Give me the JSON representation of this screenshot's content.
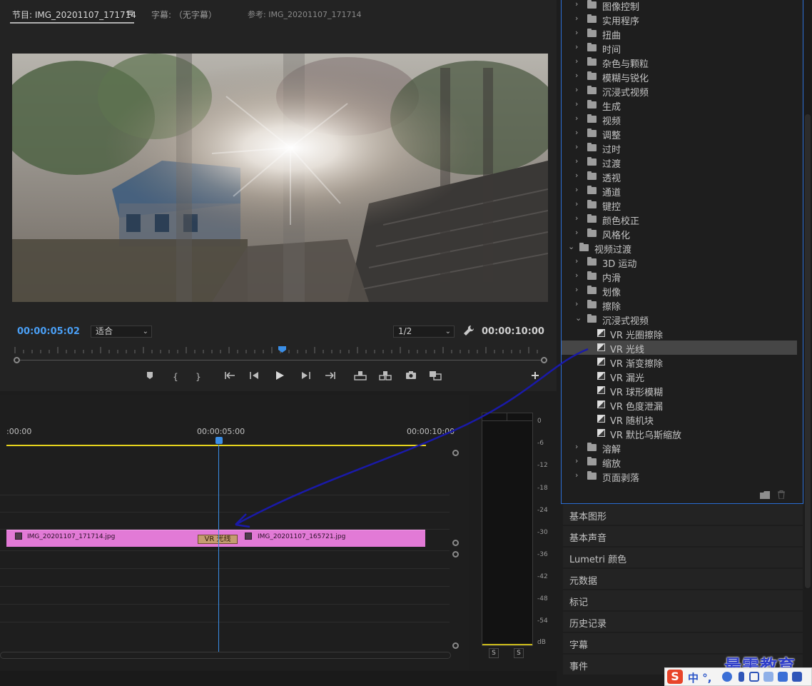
{
  "program_monitor": {
    "tab_program": "节目: IMG_20201107_171714",
    "tab_menu_icon": "hamburger-icon",
    "tab_captions": "字幕: （无字幕）",
    "tab_reference": "参考: IMG_20201107_171714",
    "current_timecode": "00:00:05:02",
    "total_timecode": "00:00:10:00",
    "fit_value": "适合",
    "resolution_value": "1/2",
    "transport_icons": [
      "marker-icon",
      "mark-in-icon",
      "mark-out-icon",
      "go-to-in-icon",
      "step-back-icon",
      "play-icon",
      "step-forward-icon",
      "go-to-out-icon",
      "lift-icon",
      "extract-icon",
      "camera-icon",
      "compare-icon",
      "add-button-icon"
    ]
  },
  "timeline": {
    "ruler_labels": [
      ":00:00",
      "00:00:05:00",
      "00:00:10:00"
    ],
    "clip_a": "IMG_20201107_171714.jpg",
    "clip_b": "IMG_20201107_165721.jpg",
    "transition": "VR 光线",
    "clip_color": "#e27ad6",
    "transition_color": "#c49c6f",
    "playhead_color": "#3a8ee6"
  },
  "audio_meter": {
    "db_labels": [
      "0",
      "-6",
      "-12",
      "-18",
      "-24",
      "-30",
      "-36",
      "-42",
      "-48",
      "-54",
      "dB"
    ],
    "solo_buttons": [
      "S",
      "S"
    ]
  },
  "effects": {
    "partial_top": "图像控制",
    "video_effect_folders": [
      "实用程序",
      "扭曲",
      "时间",
      "杂色与颗粒",
      "模糊与锐化",
      "沉浸式视频",
      "生成",
      "视频",
      "调整",
      "过时",
      "过渡",
      "透视",
      "通道",
      "键控",
      "颜色校正",
      "风格化"
    ],
    "video_transitions": "视频过渡",
    "transition_folders_before": [
      "3D 运动",
      "内滑",
      "划像",
      "擦除"
    ],
    "immersive_folder": "沉浸式视频",
    "immersive_items": [
      "VR 光圈擦除",
      "VR 光线",
      "VR 渐变擦除",
      "VR 漏光",
      "VR 球形模糊",
      "VR 色度泄漏",
      "VR 随机块",
      "VR 默比乌斯缩放"
    ],
    "selected_item": "VR 光线",
    "transition_folders_after": [
      "溶解",
      "缩放",
      "页面剥落"
    ],
    "accent_border": "#2c6fd6"
  },
  "panels": [
    "基本图形",
    "基本声音",
    "Lumetri 颜色",
    "元数据",
    "标记",
    "历史记录",
    "字幕",
    "事件"
  ],
  "overlays": {
    "watermark": "最需教育",
    "ime_text": "中 °,",
    "ime_logo": "S",
    "arrow_color": "#1a1aa8"
  }
}
